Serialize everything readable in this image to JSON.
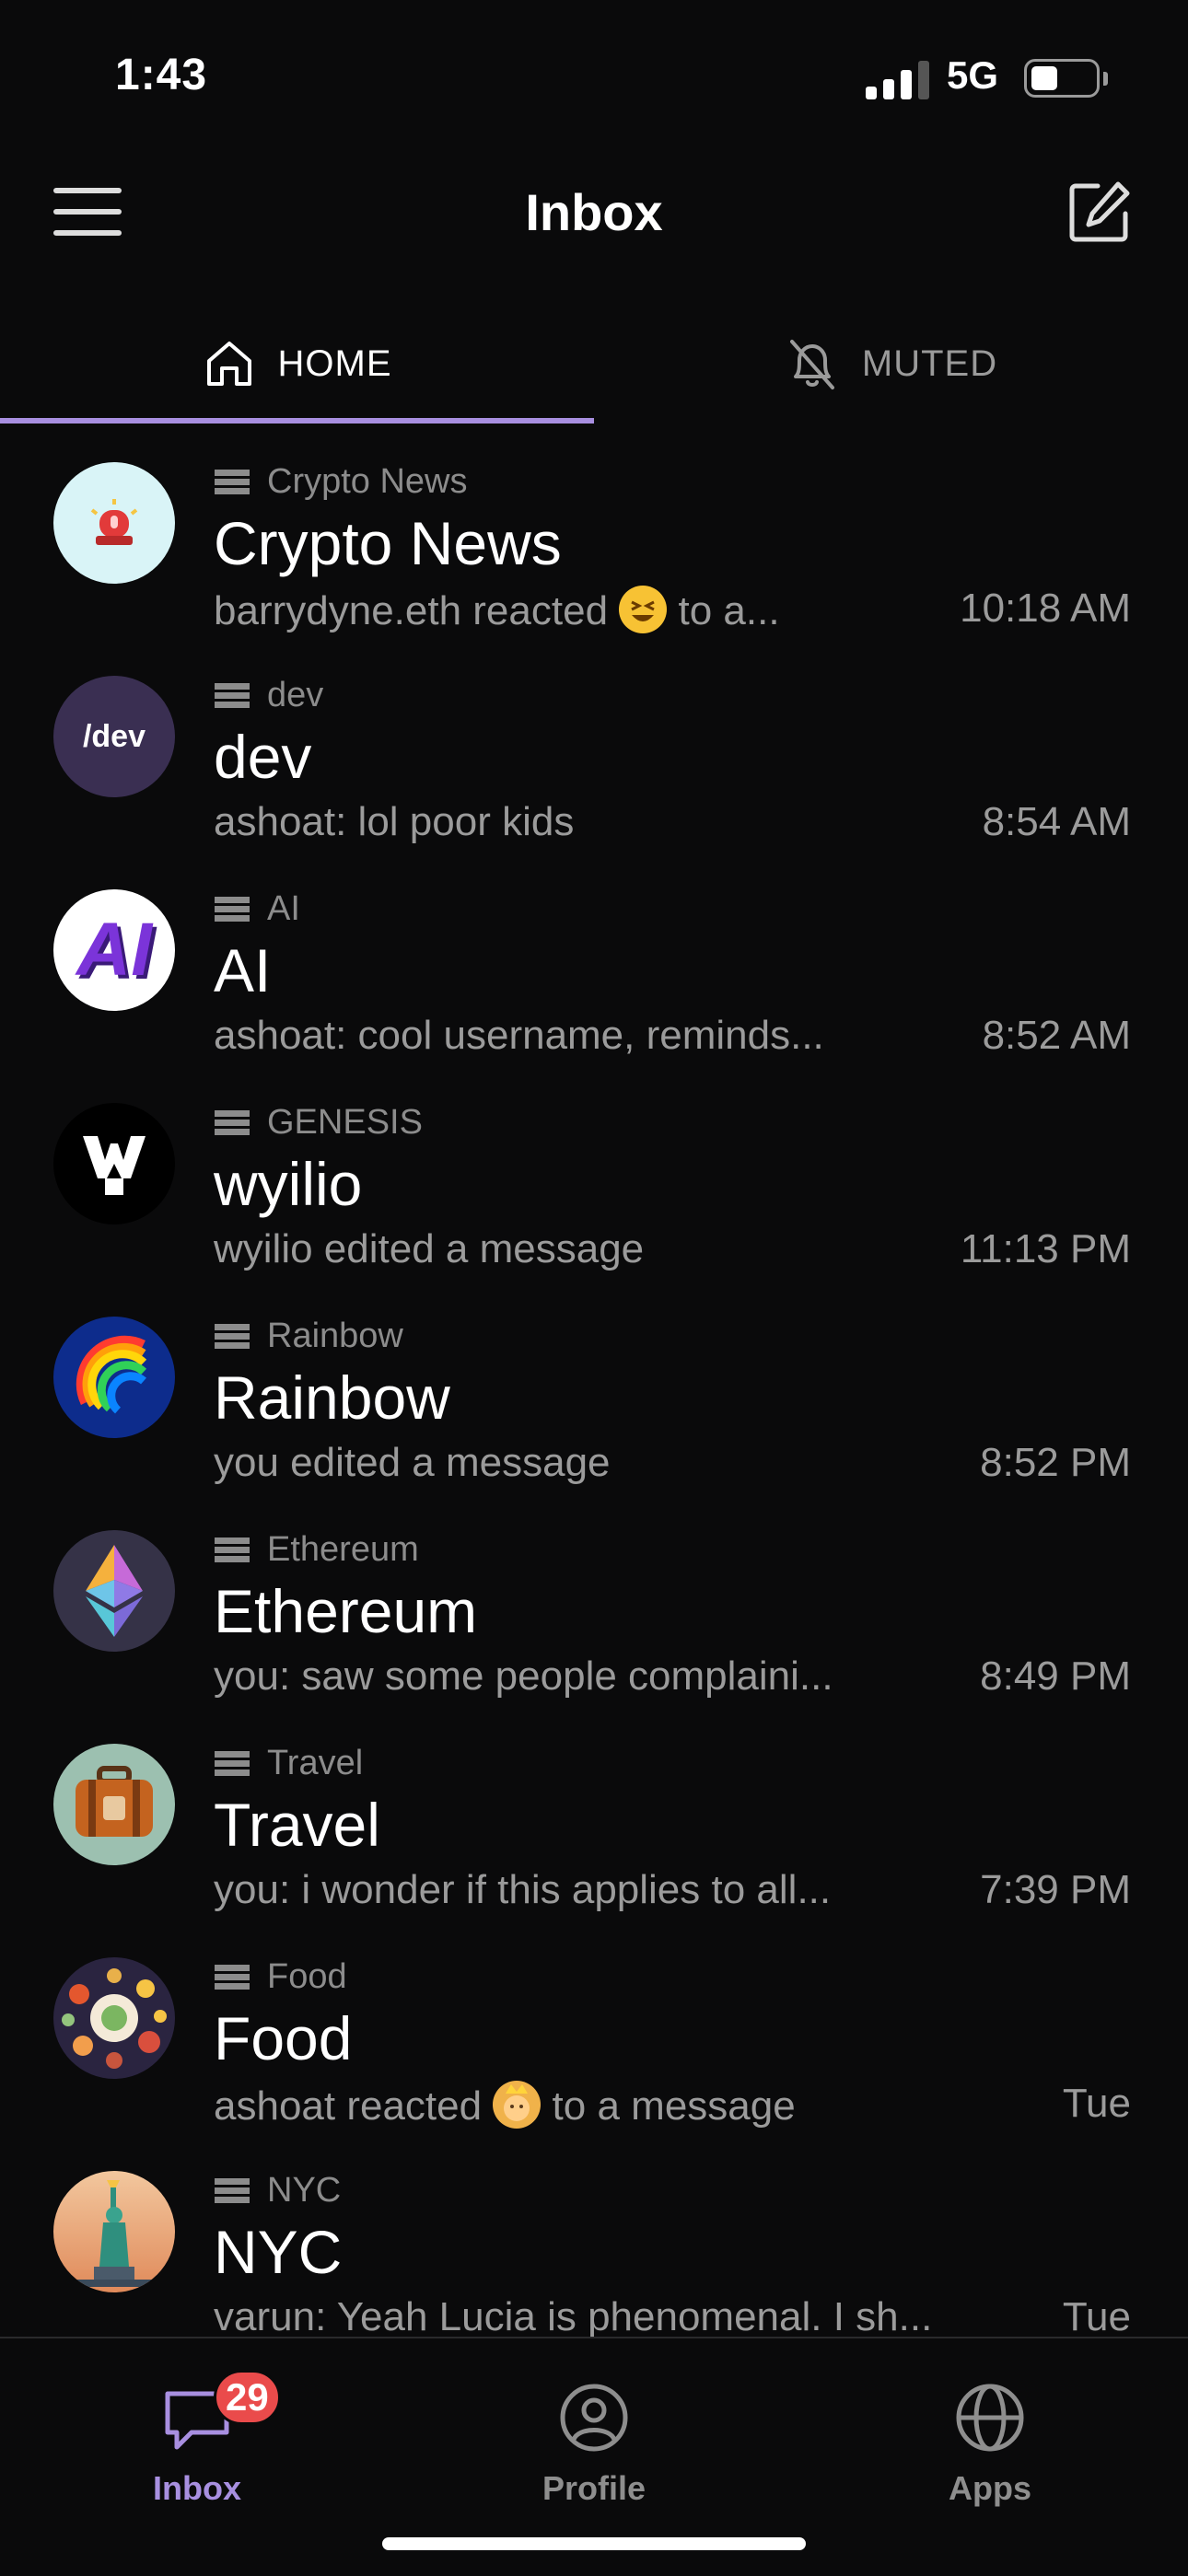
{
  "status": {
    "time": "1:43",
    "network": "5G"
  },
  "header": {
    "title": "Inbox"
  },
  "tabs": {
    "home": "HOME",
    "muted": "MUTED"
  },
  "threads": [
    {
      "community": "Crypto News",
      "name": "Crypto News",
      "preview_before": "barrydyne.eth reacted ",
      "preview_after": " to a...",
      "time": "10:18 AM",
      "avatar": "siren"
    },
    {
      "community": "dev",
      "name": "dev",
      "preview_before": "ashoat: lol poor kids",
      "preview_after": "",
      "time": "8:54 AM",
      "avatar_text": "/dev"
    },
    {
      "community": "AI",
      "name": "AI",
      "preview_before": "ashoat: cool username, reminds...",
      "preview_after": "",
      "time": "8:52 AM",
      "avatar_text": "AI"
    },
    {
      "community": "GENESIS",
      "name": "wyilio",
      "preview_before": "wyilio edited a message",
      "preview_after": "",
      "time": "11:13 PM",
      "avatar": "pixel-w"
    },
    {
      "community": "Rainbow",
      "name": "Rainbow",
      "preview_before": "you edited a message",
      "preview_after": "",
      "time": "8:52 PM",
      "avatar": "rainbow"
    },
    {
      "community": "Ethereum",
      "name": "Ethereum",
      "preview_before": "you: saw some people complaini...",
      "preview_after": "",
      "time": "8:49 PM",
      "avatar": "ethereum"
    },
    {
      "community": "Travel",
      "name": "Travel",
      "preview_before": "you: i wonder if this applies to all...",
      "preview_after": "",
      "time": "7:39 PM",
      "avatar": "suitcase"
    },
    {
      "community": "Food",
      "name": "Food",
      "preview_before": "ashoat reacted ",
      "preview_after": " to a message",
      "time": "Tue",
      "avatar": "food"
    },
    {
      "community": "NYC",
      "name": "NYC",
      "preview_before": "varun: Yeah Lucia is phenomenal. I sh...",
      "preview_after": "",
      "time": "Tue",
      "avatar": "liberty"
    }
  ],
  "tab_bar": {
    "inbox": "Inbox",
    "inbox_badge": "29",
    "profile": "Profile",
    "apps": "Apps"
  },
  "colors": {
    "accent": "#a88fe0",
    "badge": "#ea4b4b",
    "background": "#0a0a0b"
  }
}
